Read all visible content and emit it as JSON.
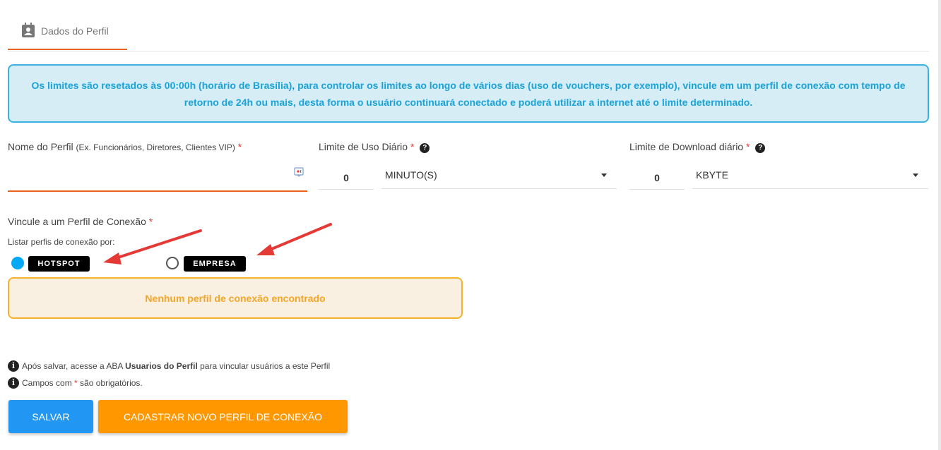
{
  "tab": {
    "label": "Dados do Perfil"
  },
  "info_message": "Os limites são resetados às 00:00h (horário de Brasília), para controlar os limites ao longo de vários dias (uso de vouchers, por exemplo), vincule em um perfil de conexão com tempo de retorno de 24h ou mais, desta forma o usuário continuará conectado e poderá utilizar a internet até o limite determinado.",
  "profile_name": {
    "label": "Nome do Perfil",
    "hint": "(Ex. Funcionários, Diretores, Clientes VIP)",
    "required": "*",
    "value": ""
  },
  "daily_usage": {
    "label": "Limite de Uso Diário",
    "required": "*",
    "help": "?",
    "value": "0",
    "unit": "MINUTO(S)"
  },
  "daily_download": {
    "label": "Limite de Download diário",
    "required": "*",
    "help": "?",
    "value": "0",
    "unit": "KBYTE"
  },
  "link_profile": {
    "label": "Vincule a um Perfil de Conexão",
    "required": "*",
    "list_by_label": "Listar perfis de conexão por:",
    "options": [
      {
        "label": "HOTSPOT",
        "selected": true
      },
      {
        "label": "EMPRESA",
        "selected": false
      }
    ],
    "empty_message": "Nenhum perfil de conexão encontrado"
  },
  "notes": {
    "note1_prefix": "Após salvar, acesse a ABA ",
    "note1_bold": "Usuarios do Perfil",
    "note1_suffix": " para vincular usuários a este Perfil",
    "note2_prefix": "Campos com ",
    "note2_star": "*",
    "note2_suffix": " são obrigatórios."
  },
  "buttons": {
    "save": "SALVAR",
    "new_connection_profile": "CADASTRAR NOVO PERFIL DE CONEXÃO"
  },
  "colors": {
    "accent_orange": "#e8641e",
    "info_blue": "#1aa3d8",
    "save_blue": "#2196f3",
    "warn_orange": "#ff9800",
    "arrow_red": "#e53935"
  }
}
